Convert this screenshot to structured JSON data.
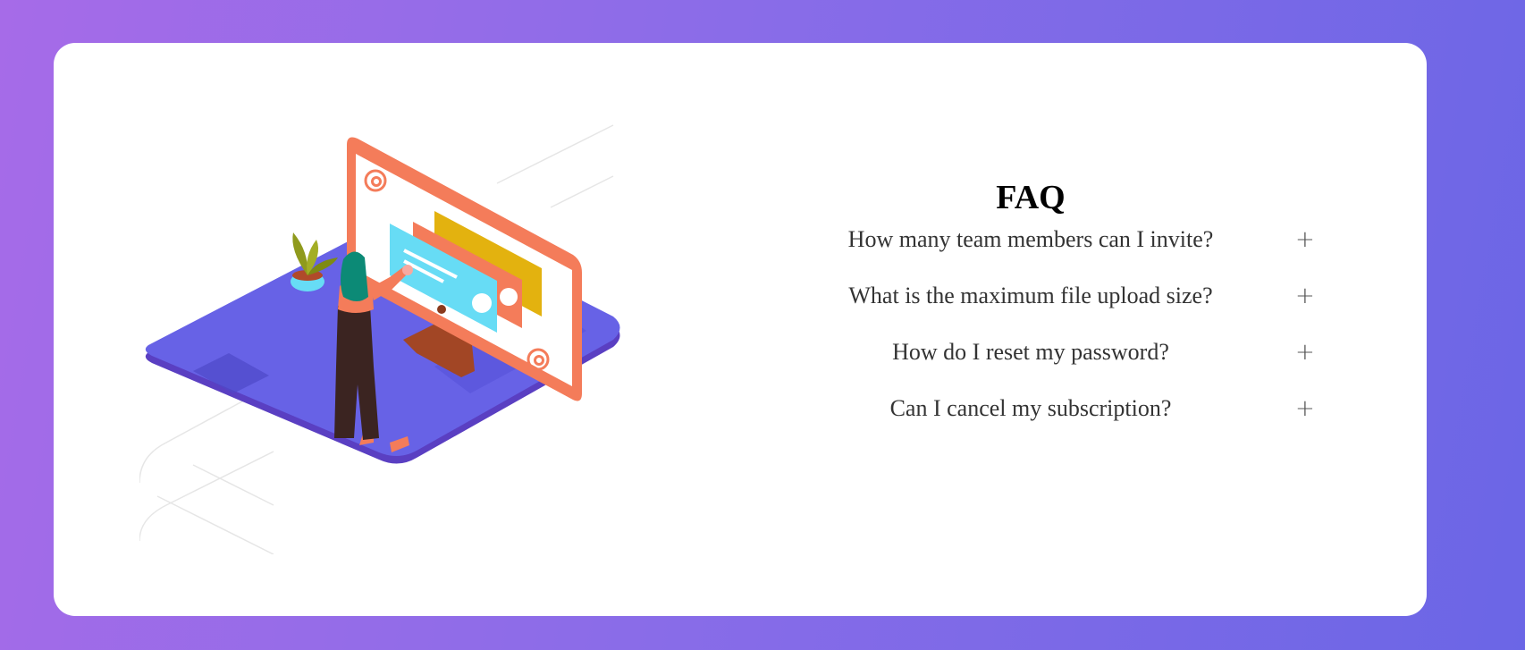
{
  "faq": {
    "title": "FAQ",
    "items": [
      {
        "question": "How many team members can I invite?",
        "toggle": "+"
      },
      {
        "question": "What is the maximum file upload size?",
        "toggle": "+"
      },
      {
        "question": "How do I reset my password?",
        "toggle": "+"
      },
      {
        "question": "Can I cancel my subscription?",
        "toggle": "+"
      }
    ]
  },
  "colors": {
    "background_start": "#a66be8",
    "background_end": "#6b66e6",
    "platform": "#6762e6",
    "monitor_frame": "#f47c5a",
    "message_cyan": "#67dcf5",
    "message_yellow": "#e3b20f",
    "plant": "#8f9a1c"
  },
  "illustration": {
    "icons": [
      "at-sign-icon",
      "at-sign-icon"
    ]
  }
}
